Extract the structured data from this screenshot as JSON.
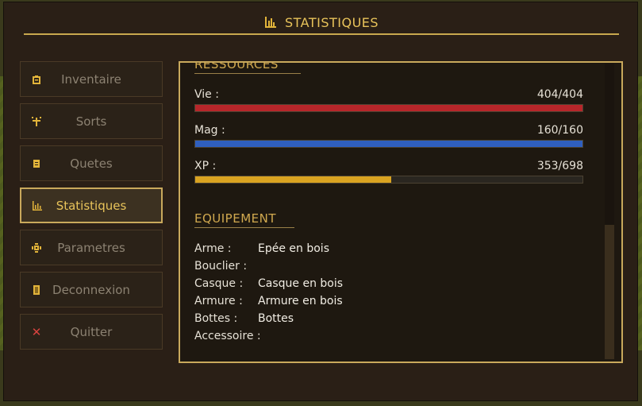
{
  "header": {
    "title": "STATISTIQUES",
    "icon": "bar-chart-icon"
  },
  "nav": {
    "items": [
      {
        "label": "Inventaire",
        "icon": "backpack-icon",
        "active": false
      },
      {
        "label": "Sorts",
        "icon": "spell-icon",
        "active": false
      },
      {
        "label": "Quetes",
        "icon": "scroll-icon",
        "active": false
      },
      {
        "label": "Statistiques",
        "icon": "bar-chart-icon",
        "active": true
      },
      {
        "label": "Parametres",
        "icon": "gear-icon",
        "active": false
      },
      {
        "label": "Deconnexion",
        "icon": "door-icon",
        "active": false
      },
      {
        "label": "Quitter",
        "icon": "close-icon",
        "active": false
      }
    ]
  },
  "ressources": {
    "title": "RESSOURCES",
    "stats": [
      {
        "label": "Vie :",
        "value": "404/404",
        "current": 404,
        "max": 404,
        "color": "#b7262a"
      },
      {
        "label": "Mag :",
        "value": "160/160",
        "current": 160,
        "max": 160,
        "color": "#2f5fbf"
      },
      {
        "label": "XP :",
        "value": "353/698",
        "current": 353,
        "max": 698,
        "color": "#d9a321"
      }
    ]
  },
  "equipement": {
    "title": "EQUIPEMENT",
    "items": [
      {
        "label": "Arme :",
        "value": "Epée en bois"
      },
      {
        "label": "Bouclier :",
        "value": ""
      },
      {
        "label": "Casque :",
        "value": "Casque en bois"
      },
      {
        "label": "Armure :",
        "value": "Armure en bois"
      },
      {
        "label": "Bottes :",
        "value": "Bottes"
      },
      {
        "label": "Accessoire :",
        "value": ""
      }
    ]
  },
  "colors": {
    "accent": "#c9a95c",
    "title": "#e8c35a",
    "panel_bg": "#1e1810"
  }
}
